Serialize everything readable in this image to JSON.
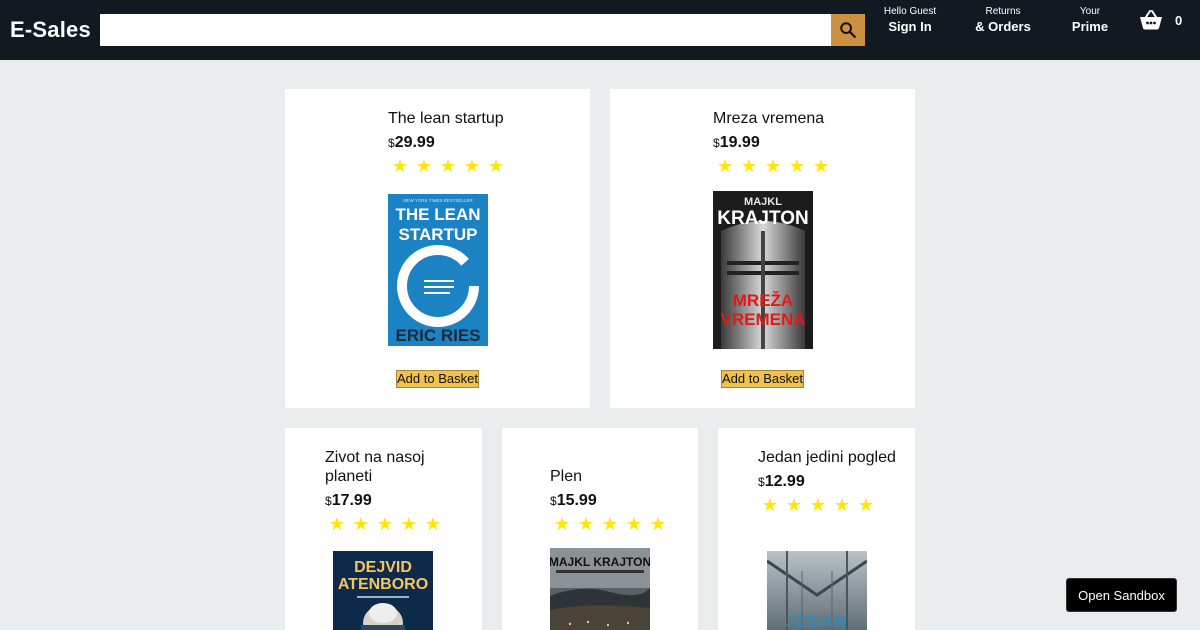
{
  "header": {
    "logo": "E-Sales",
    "search": {
      "value": "",
      "placeholder": ""
    },
    "search_icon": "search-icon",
    "signin": {
      "line1": "Hello Guest",
      "line2": "Sign In"
    },
    "orders": {
      "line1": "Returns",
      "line2": "& Orders"
    },
    "prime": {
      "line1": "Your",
      "line2": "Prime"
    },
    "basket": {
      "icon": "basket-icon",
      "count": "0"
    },
    "colors": {
      "bar": "#131921",
      "search_button": "#cd9042"
    }
  },
  "currency": "$",
  "star": "★",
  "add_label": "Add to Basket",
  "products": [
    {
      "title": "The lean startup",
      "price": "29.99",
      "rating": 5,
      "cover": {
        "top": "NEW YORK TIMES BESTSELLER",
        "line1": "THE LEAN",
        "line2": "STARTUP",
        "author": "ERIC RIES"
      }
    },
    {
      "title": "Mreza vremena",
      "price": "19.99",
      "rating": 5,
      "cover": {
        "author1": "MAJKL",
        "author2": "KRAJTON",
        "line1": "MREŽA",
        "line2": "VREMENA"
      }
    },
    {
      "title": "Zivot na nasoj planeti",
      "price": "17.99",
      "rating": 5,
      "cover": {
        "line1": "DEJVID",
        "line2": "ATENBORO"
      }
    },
    {
      "title": "Plen",
      "price": "15.99",
      "rating": 5,
      "cover": {
        "author": "MAJKL KRAJTON"
      }
    },
    {
      "title": "Jedan jedini pogled",
      "price": "12.99",
      "rating": 5,
      "cover": {
        "line1": "JEDAN"
      }
    }
  ],
  "sandbox": {
    "label": "Open Sandbox"
  }
}
